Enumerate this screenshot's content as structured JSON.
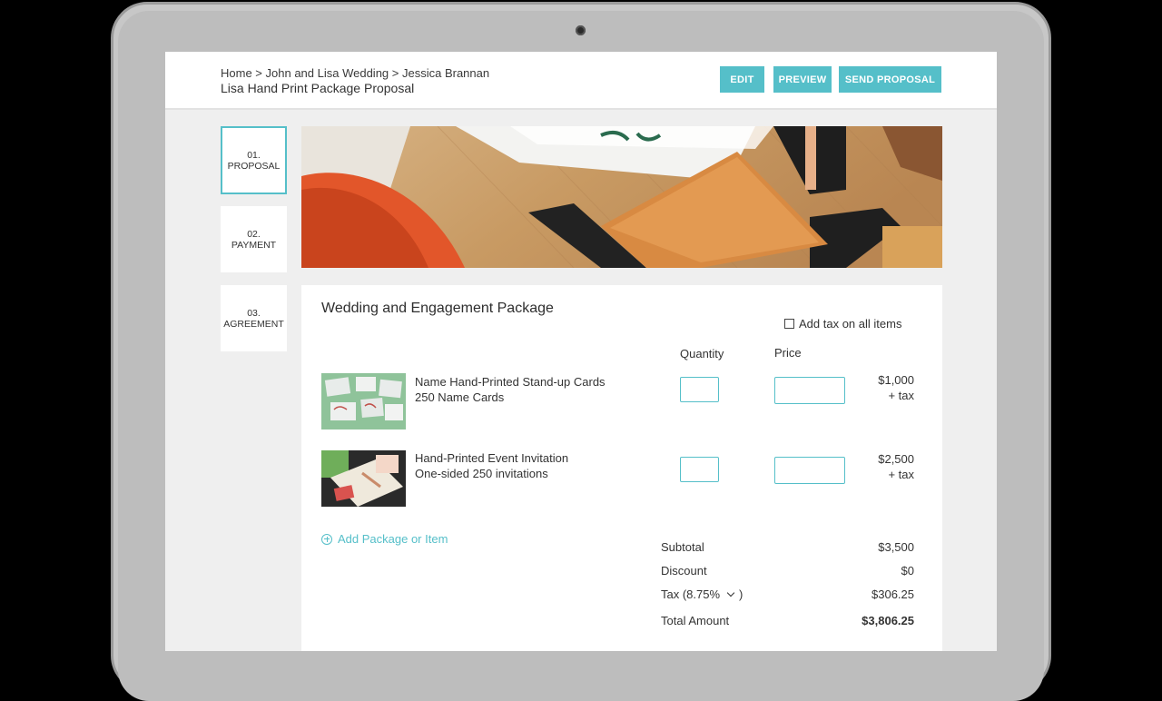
{
  "breadcrumb": {
    "home": "Home",
    "sep": " > ",
    "project": "John and Lisa Wedding",
    "client": "Jessica Brannan"
  },
  "page_title": "Lisa Hand Print Package Proposal",
  "actions": {
    "edit": "EDIT",
    "preview": "PREVIEW",
    "send": "SEND PROPOSAL"
  },
  "steps": [
    {
      "num": "01.",
      "label": "PROPOSAL"
    },
    {
      "num": "02.",
      "label": "PAYMENT"
    },
    {
      "num": "03.",
      "label": "AGREEMENT"
    }
  ],
  "package": {
    "title": "Wedding and Engagement Package",
    "tax_all_label": "Add tax on all items",
    "col_quantity": "Quantity",
    "col_price": "Price",
    "items": [
      {
        "name": "Name Hand-Printed Stand-up Cards",
        "detail": "250 Name Cards",
        "price": "$1,000",
        "tax": "+ tax"
      },
      {
        "name": "Hand-Printed Event Invitation",
        "detail": "One-sided 250 invitations",
        "price": "$2,500",
        "tax": "+ tax"
      }
    ],
    "add_item_label": "Add Package or Item"
  },
  "summary": {
    "subtotal_label": "Subtotal",
    "subtotal": "$3,500",
    "discount_label": "Discount",
    "discount": "$0",
    "tax_label": "Tax (8.75%",
    "tax_close": ")",
    "tax": "$306.25",
    "total_label": "Total Amount",
    "total": "$3,806.25"
  },
  "colors": {
    "accent": "#55bfc9"
  }
}
